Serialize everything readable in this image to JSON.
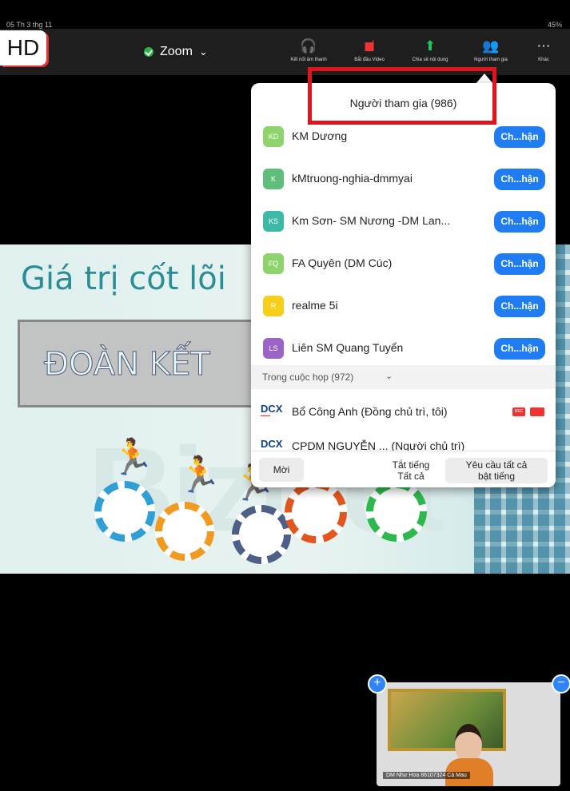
{
  "status": {
    "time": "05 Th 3 thg 11",
    "battery": "45%"
  },
  "hd_badge": "HD",
  "meeting": {
    "app_title": "Zoom",
    "title_chevron": "⌄"
  },
  "toolbar": [
    {
      "label": "Kết nối âm thanh",
      "icon": "headphones-icon"
    },
    {
      "label": "Bắt đầu Video",
      "icon": "video-off-icon"
    },
    {
      "label": "Chia sẻ nội dung",
      "icon": "share-screen-icon"
    },
    {
      "label": "Người tham gia",
      "icon": "participants-icon"
    },
    {
      "label": "Khác",
      "icon": "more-icon"
    }
  ],
  "slide": {
    "title": "Giá trị cốt lõi",
    "banner": "ĐOÀN KẾT",
    "background_word": "BizNet"
  },
  "participants_panel": {
    "header": "Người tham gia (986)",
    "participants": [
      {
        "initials": "KD",
        "name": "KM Dương",
        "color": "#8ed36b",
        "action": "Ch...hận"
      },
      {
        "initials": "K",
        "name": "kMtruong-nghia-dmmyai",
        "color": "#5fbf7a",
        "action": "Ch...hận"
      },
      {
        "initials": "KS",
        "name": "Km Sơn- SM Nương -DM Lan...",
        "color": "#3db9a7",
        "action": "Ch...hận"
      },
      {
        "initials": "FQ",
        "name": "FA Quyên (DM Cúc)",
        "color": "#8ed36b",
        "action": "Ch...hận"
      },
      {
        "initials": "R",
        "name": "realme 5i",
        "color": "#f7cf1a",
        "action": "Ch...hận"
      },
      {
        "initials": "LS",
        "name": "Liên SM Quang Tuyển",
        "color": "#9c64c8",
        "action": "Ch...hận"
      }
    ],
    "in_meeting_section": "Trong cuộc họp (972)",
    "hosts": [
      {
        "logo": "DCX",
        "name": "Bổ Công Anh (Đồng chủ trì, tôi)"
      },
      {
        "logo": "DCX",
        "name": "CPDM NGUYỄN ... (Người chủ trì)"
      }
    ],
    "footer": {
      "invite": "Mời",
      "mute_all_line1": "Tắt tiếng",
      "mute_all_line2": "Tất cả",
      "ask_unmute_line1": "Yêu cầu tất cả",
      "ask_unmute_line2": "bật tiếng"
    }
  },
  "video_thumbnail": {
    "label": "DM Như Hoa 86107324 Cà Mau"
  },
  "colors": {
    "accent_blue": "#1f7cf2",
    "highlight_red": "#e0141a",
    "brand_teal": "#2b8d96"
  }
}
